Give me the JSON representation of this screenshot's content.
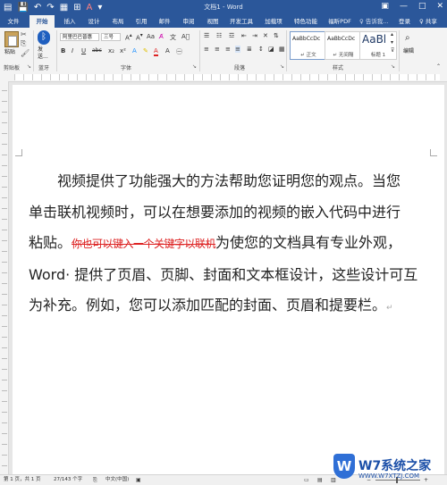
{
  "titlebar": {
    "document_title": "文档1 - Word",
    "qat_icons": [
      "save-icon",
      "undo-icon",
      "redo-icon",
      "font-color-icon",
      "customize-icon"
    ],
    "window_controls": [
      "ribbon-display-icon",
      "minimize-icon",
      "maximize-icon",
      "close-icon"
    ]
  },
  "tabs": [
    {
      "label": "文件"
    },
    {
      "label": "开始"
    },
    {
      "label": "插入"
    },
    {
      "label": "设计"
    },
    {
      "label": "布局"
    },
    {
      "label": "引用"
    },
    {
      "label": "邮件"
    },
    {
      "label": "审阅"
    },
    {
      "label": "视图"
    },
    {
      "label": "开发工具"
    },
    {
      "label": "加载项"
    },
    {
      "label": "特色功能"
    },
    {
      "label": "福昕PDF"
    }
  ],
  "tell_me": "♀ 告诉我...",
  "login": "登录",
  "share": "♀ 共享",
  "ribbon": {
    "clipboard": {
      "paste": "粘贴",
      "label": "剪贴板"
    },
    "bluetooth": {
      "send": "发送...",
      "label": "蓝牙"
    },
    "font": {
      "name": "阿里巴巴普惠",
      "size": "三号",
      "label": "字体",
      "format_buttons": [
        "B",
        "I",
        "U",
        "abc",
        "x₂",
        "x²"
      ]
    },
    "paragraph": {
      "label": "段落"
    },
    "styles": {
      "label": "样式",
      "items": [
        {
          "sample": "AaBbCcDc",
          "name": "↵ 正文"
        },
        {
          "sample": "AaBbCcDc",
          "name": "↵ 无间隔"
        },
        {
          "sample": "AaBl",
          "name": "标题 1"
        }
      ]
    },
    "editing": {
      "label": "编辑"
    }
  },
  "document": {
    "line1": "视频提供了功能强大的方法帮助您证明您的观点。当您",
    "line2": "单击联机视频时，可以在想要添加的视频的嵌入代码中进行",
    "line3_start": "粘贴。",
    "line3_red": "你也可以键入一个关键字以联机",
    "line3_end": "为使您的文档具有专业外观，",
    "line4": "Word· 提供了页眉、页脚、封面和文本框设计，这些设计可互",
    "line5": "为补充。例如，您可以添加匹配的封面、页眉和提要栏。",
    "para_mark": "↵"
  },
  "status": {
    "page": "第 1 页，共 1 页",
    "words": "27/143 个字",
    "language": "中文(中国)"
  },
  "watermark": {
    "text": "W7系统之家",
    "letter": "W",
    "sub": "WWW.W7XTZJ.COM"
  }
}
